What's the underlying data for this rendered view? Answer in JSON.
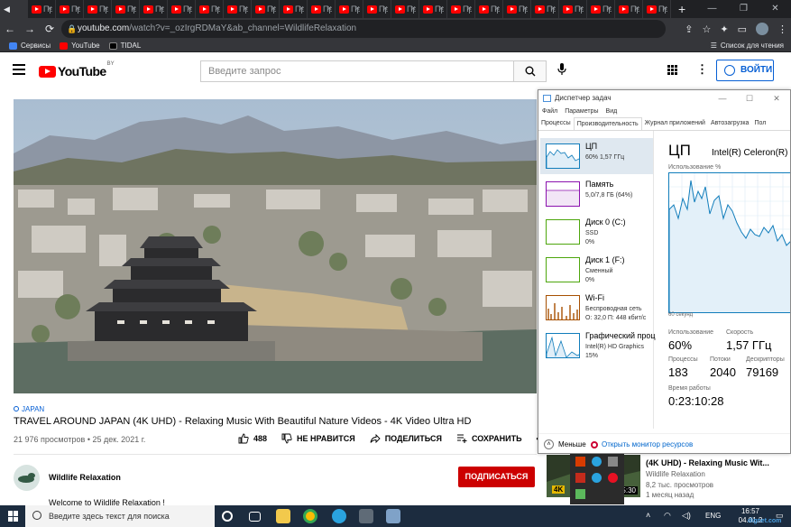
{
  "browser": {
    "tab_label": "Пр",
    "active_tab_label": "◀",
    "url_host": "youtube.com",
    "url_path": "/watch?v=_ozIrgRDMaY&ab_channel=WildlifeRelaxation",
    "bookmarks": [
      "Сервисы",
      "YouTube",
      "TIDAL"
    ],
    "reading_list": "Список для чтения"
  },
  "youtube": {
    "logo_text": "YouTube",
    "logo_country": "BY",
    "search_placeholder": "Введите запрос",
    "signin_label": "ВОЙТИ",
    "video": {
      "tag": "JAPAN",
      "title": "TRAVEL AROUND JAPAN (4K UHD) - Relaxing Music With Beautiful Nature Videos - 4K Video Ultra HD",
      "meta": "21 976 просмотров • 25 дек. 2021 г.",
      "likes": "488",
      "dislike_label": "НЕ НРАВИТСЯ",
      "share_label": "ПОДЕЛИТЬСЯ",
      "save_label": "СОХРАНИТЬ"
    },
    "channel": {
      "name": "Wildlife Relaxation",
      "subscribe_label": "ПОДПИСАТЬСЯ",
      "description": "Welcome to Wildlife Relaxation !"
    },
    "suggested": {
      "title": "(4K UHD) - Relaxing Music Wit...",
      "channel": "Wildlife Relaxation",
      "views": "8,2 тыс. просмотров",
      "age": "1 месяц назад",
      "duration": "35:30",
      "badge": "4K"
    }
  },
  "task_manager": {
    "title": "Диспетчер задач",
    "menu": [
      "Файл",
      "Параметры",
      "Вид"
    ],
    "tabs": [
      "Процессы",
      "Производительность",
      "Журнал приложений",
      "Автозагрузка",
      "Пол"
    ],
    "resources": [
      {
        "name": "ЦП",
        "line1": "60%  1,57 ГГц",
        "line2": ""
      },
      {
        "name": "Память",
        "line1": "5,0/7,8 ГБ (64%)",
        "line2": ""
      },
      {
        "name": "Диск 0 (C:)",
        "line1": "SSD",
        "line2": "0%"
      },
      {
        "name": "Диск 1 (F:)",
        "line1": "Сменный",
        "line2": "0%"
      },
      {
        "name": "Wi-Fi",
        "line1": "Беспроводная сеть",
        "line2": "О: 32,0  П: 448 кбит/с"
      },
      {
        "name": "Графический проц",
        "line1": "Intel(R) HD Graphics",
        "line2": "15%"
      }
    ],
    "detail": {
      "heading": "ЦП",
      "cpu_name": "Intel(R) Celeron(R) C",
      "usage_label": "Использование %",
      "time_label": "60 секунд",
      "utilization_label": "Использование",
      "utilization_value": "60%",
      "speed_label": "Скорость",
      "speed_value": "1,57 ГГц",
      "processes_label": "Процессы",
      "processes_value": "183",
      "threads_label": "Потоки",
      "threads_value": "2040",
      "handles_label": "Дескрипторы",
      "handles_value": "79169",
      "uptime_label": "Время работы",
      "uptime_value": "0:23:10:28"
    },
    "less_label": "Меньше",
    "monitor_label": "Открыть монитор ресурсов"
  },
  "taskbar": {
    "search_placeholder": "Введите здесь текст для поиска",
    "lang": "ENG",
    "time": "16:57",
    "date": "04.01.2"
  },
  "watermark": "dignet.com",
  "colors": {
    "youtube_red": "#ff0000",
    "subscribe_red": "#cc0000",
    "cpu_graph": "#117dbb",
    "link_blue": "#065fd4"
  }
}
